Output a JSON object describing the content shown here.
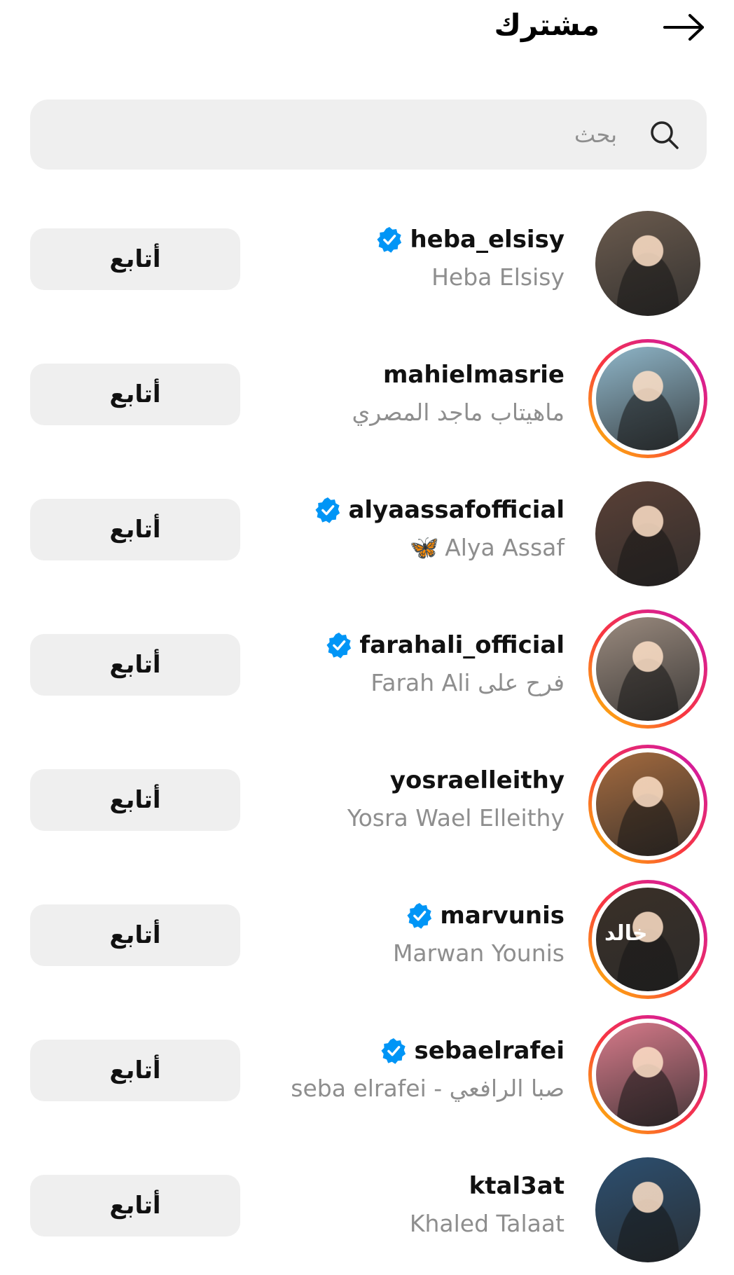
{
  "header": {
    "title": "مشترك",
    "back_icon": "arrow-right-icon"
  },
  "search": {
    "placeholder": "بحث",
    "icon": "search-icon"
  },
  "follow_label": "أتابع",
  "accounts": [
    {
      "username": "heba_elsisy",
      "full_name": "Heba Elsisy",
      "verified": true,
      "story_ring": false,
      "avatar_color": "#6b5b4e"
    },
    {
      "username": "mahielmasrie",
      "full_name": "ماهيتاب ماجد المصري",
      "verified": false,
      "story_ring": true,
      "avatar_color": "#8fb6c9"
    },
    {
      "username": "alyaassafofficial",
      "full_name": "Alya Assaf",
      "full_name_emoji": "🦋",
      "verified": true,
      "story_ring": false,
      "avatar_color": "#5a4036"
    },
    {
      "username": "farahali_official",
      "full_name": "Farah Ali فرح على",
      "verified": true,
      "story_ring": true,
      "avatar_color": "#9a8a7e"
    },
    {
      "username": "yosraelleithy",
      "full_name": "Yosra Wael Elleithy",
      "verified": false,
      "story_ring": true,
      "avatar_color": "#a46a3e"
    },
    {
      "username": "marvunis",
      "full_name": "Marwan Younis",
      "verified": true,
      "story_ring": true,
      "avatar_color": "#3a3028",
      "avatar_text": "خالد"
    },
    {
      "username": "sebaelrafei",
      "full_name": "seba elrafei - صبا الرافعي",
      "verified": true,
      "story_ring": true,
      "avatar_color": "#d77a8a"
    },
    {
      "username": "ktal3at",
      "full_name": "Khaled Talaat",
      "verified": false,
      "story_ring": false,
      "avatar_color": "#2c4f70"
    }
  ]
}
